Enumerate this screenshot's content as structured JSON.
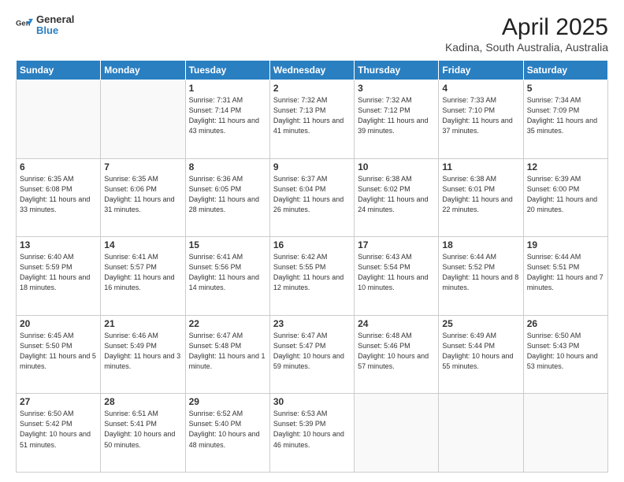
{
  "logo": {
    "line1": "General",
    "line2": "Blue"
  },
  "title": "April 2025",
  "subtitle": "Kadina, South Australia, Australia",
  "days_of_week": [
    "Sunday",
    "Monday",
    "Tuesday",
    "Wednesday",
    "Thursday",
    "Friday",
    "Saturday"
  ],
  "weeks": [
    [
      {
        "day": null
      },
      {
        "day": null
      },
      {
        "day": "1",
        "sunrise": "7:31 AM",
        "sunset": "7:14 PM",
        "daylight": "11 hours and 43 minutes."
      },
      {
        "day": "2",
        "sunrise": "7:32 AM",
        "sunset": "7:13 PM",
        "daylight": "11 hours and 41 minutes."
      },
      {
        "day": "3",
        "sunrise": "7:32 AM",
        "sunset": "7:12 PM",
        "daylight": "11 hours and 39 minutes."
      },
      {
        "day": "4",
        "sunrise": "7:33 AM",
        "sunset": "7:10 PM",
        "daylight": "11 hours and 37 minutes."
      },
      {
        "day": "5",
        "sunrise": "7:34 AM",
        "sunset": "7:09 PM",
        "daylight": "11 hours and 35 minutes."
      }
    ],
    [
      {
        "day": "6",
        "sunrise": "6:35 AM",
        "sunset": "6:08 PM",
        "daylight": "11 hours and 33 minutes."
      },
      {
        "day": "7",
        "sunrise": "6:35 AM",
        "sunset": "6:06 PM",
        "daylight": "11 hours and 31 minutes."
      },
      {
        "day": "8",
        "sunrise": "6:36 AM",
        "sunset": "6:05 PM",
        "daylight": "11 hours and 28 minutes."
      },
      {
        "day": "9",
        "sunrise": "6:37 AM",
        "sunset": "6:04 PM",
        "daylight": "11 hours and 26 minutes."
      },
      {
        "day": "10",
        "sunrise": "6:38 AM",
        "sunset": "6:02 PM",
        "daylight": "11 hours and 24 minutes."
      },
      {
        "day": "11",
        "sunrise": "6:38 AM",
        "sunset": "6:01 PM",
        "daylight": "11 hours and 22 minutes."
      },
      {
        "day": "12",
        "sunrise": "6:39 AM",
        "sunset": "6:00 PM",
        "daylight": "11 hours and 20 minutes."
      }
    ],
    [
      {
        "day": "13",
        "sunrise": "6:40 AM",
        "sunset": "5:59 PM",
        "daylight": "11 hours and 18 minutes."
      },
      {
        "day": "14",
        "sunrise": "6:41 AM",
        "sunset": "5:57 PM",
        "daylight": "11 hours and 16 minutes."
      },
      {
        "day": "15",
        "sunrise": "6:41 AM",
        "sunset": "5:56 PM",
        "daylight": "11 hours and 14 minutes."
      },
      {
        "day": "16",
        "sunrise": "6:42 AM",
        "sunset": "5:55 PM",
        "daylight": "11 hours and 12 minutes."
      },
      {
        "day": "17",
        "sunrise": "6:43 AM",
        "sunset": "5:54 PM",
        "daylight": "11 hours and 10 minutes."
      },
      {
        "day": "18",
        "sunrise": "6:44 AM",
        "sunset": "5:52 PM",
        "daylight": "11 hours and 8 minutes."
      },
      {
        "day": "19",
        "sunrise": "6:44 AM",
        "sunset": "5:51 PM",
        "daylight": "11 hours and 7 minutes."
      }
    ],
    [
      {
        "day": "20",
        "sunrise": "6:45 AM",
        "sunset": "5:50 PM",
        "daylight": "11 hours and 5 minutes."
      },
      {
        "day": "21",
        "sunrise": "6:46 AM",
        "sunset": "5:49 PM",
        "daylight": "11 hours and 3 minutes."
      },
      {
        "day": "22",
        "sunrise": "6:47 AM",
        "sunset": "5:48 PM",
        "daylight": "11 hours and 1 minute."
      },
      {
        "day": "23",
        "sunrise": "6:47 AM",
        "sunset": "5:47 PM",
        "daylight": "10 hours and 59 minutes."
      },
      {
        "day": "24",
        "sunrise": "6:48 AM",
        "sunset": "5:46 PM",
        "daylight": "10 hours and 57 minutes."
      },
      {
        "day": "25",
        "sunrise": "6:49 AM",
        "sunset": "5:44 PM",
        "daylight": "10 hours and 55 minutes."
      },
      {
        "day": "26",
        "sunrise": "6:50 AM",
        "sunset": "5:43 PM",
        "daylight": "10 hours and 53 minutes."
      }
    ],
    [
      {
        "day": "27",
        "sunrise": "6:50 AM",
        "sunset": "5:42 PM",
        "daylight": "10 hours and 51 minutes."
      },
      {
        "day": "28",
        "sunrise": "6:51 AM",
        "sunset": "5:41 PM",
        "daylight": "10 hours and 50 minutes."
      },
      {
        "day": "29",
        "sunrise": "6:52 AM",
        "sunset": "5:40 PM",
        "daylight": "10 hours and 48 minutes."
      },
      {
        "day": "30",
        "sunrise": "6:53 AM",
        "sunset": "5:39 PM",
        "daylight": "10 hours and 46 minutes."
      },
      {
        "day": null
      },
      {
        "day": null
      },
      {
        "day": null
      }
    ]
  ]
}
